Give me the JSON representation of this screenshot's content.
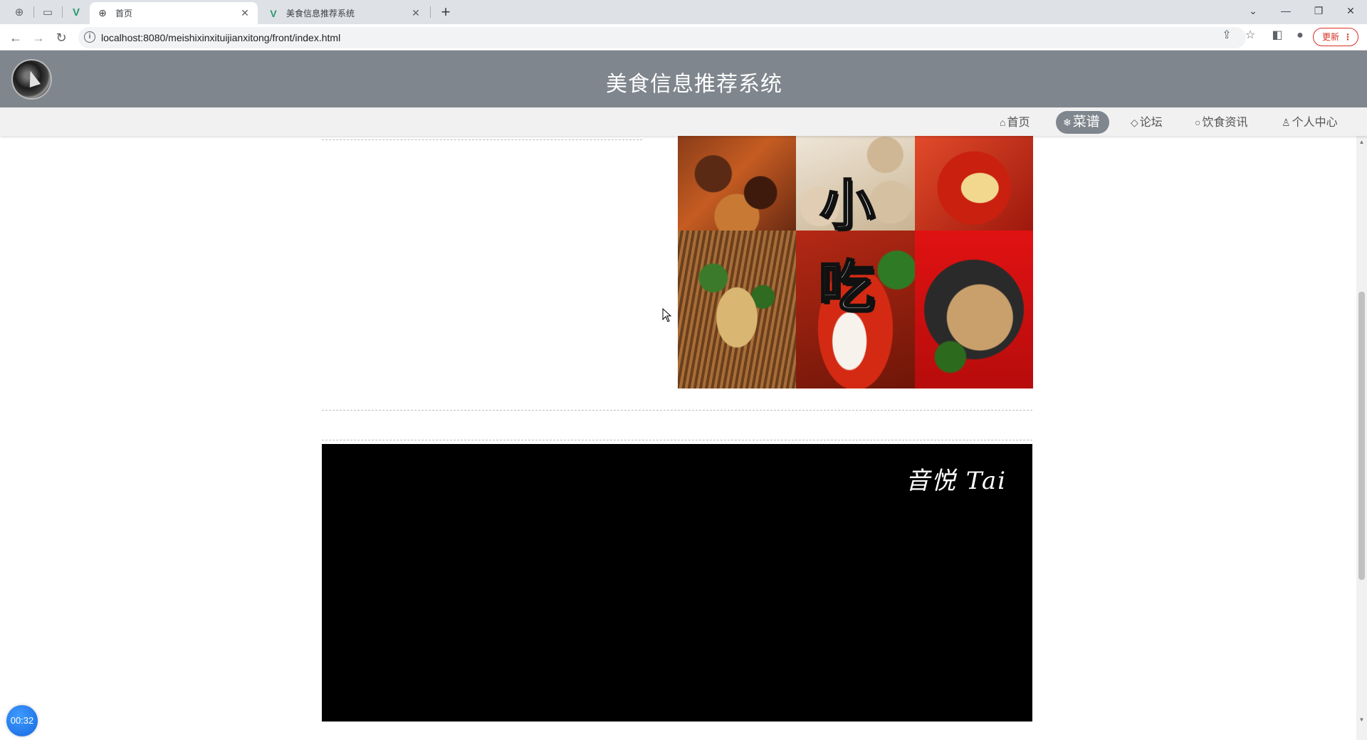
{
  "browser": {
    "tabs": [
      {
        "title": "首页",
        "favicon": "globe-icon",
        "active": true
      },
      {
        "title": "美食信息推荐系统",
        "favicon": "vue-logo-icon",
        "active": false
      }
    ],
    "url": "localhost:8080/meishixinxituijianxitong/front/index.html",
    "update_label": "更新"
  },
  "site": {
    "title": "美食信息推荐系统",
    "nav": [
      {
        "label": "首页",
        "icon": "home-icon",
        "active": false
      },
      {
        "label": "菜谱",
        "icon": "snowflake-icon",
        "active": true
      },
      {
        "label": "论坛",
        "icon": "tag-icon",
        "active": false
      },
      {
        "label": "饮食资讯",
        "icon": "circle-icon",
        "active": false
      },
      {
        "label": "个人中心",
        "icon": "user-icon",
        "active": false
      }
    ]
  },
  "collage": {
    "chars": [
      "小",
      "吃"
    ]
  },
  "video": {
    "watermark": "音悦 Tai"
  },
  "timer": "00:32",
  "colors": {
    "header": "#7f868d",
    "nav_bg": "#f1f1f1",
    "active_nav": "#7f868d"
  }
}
